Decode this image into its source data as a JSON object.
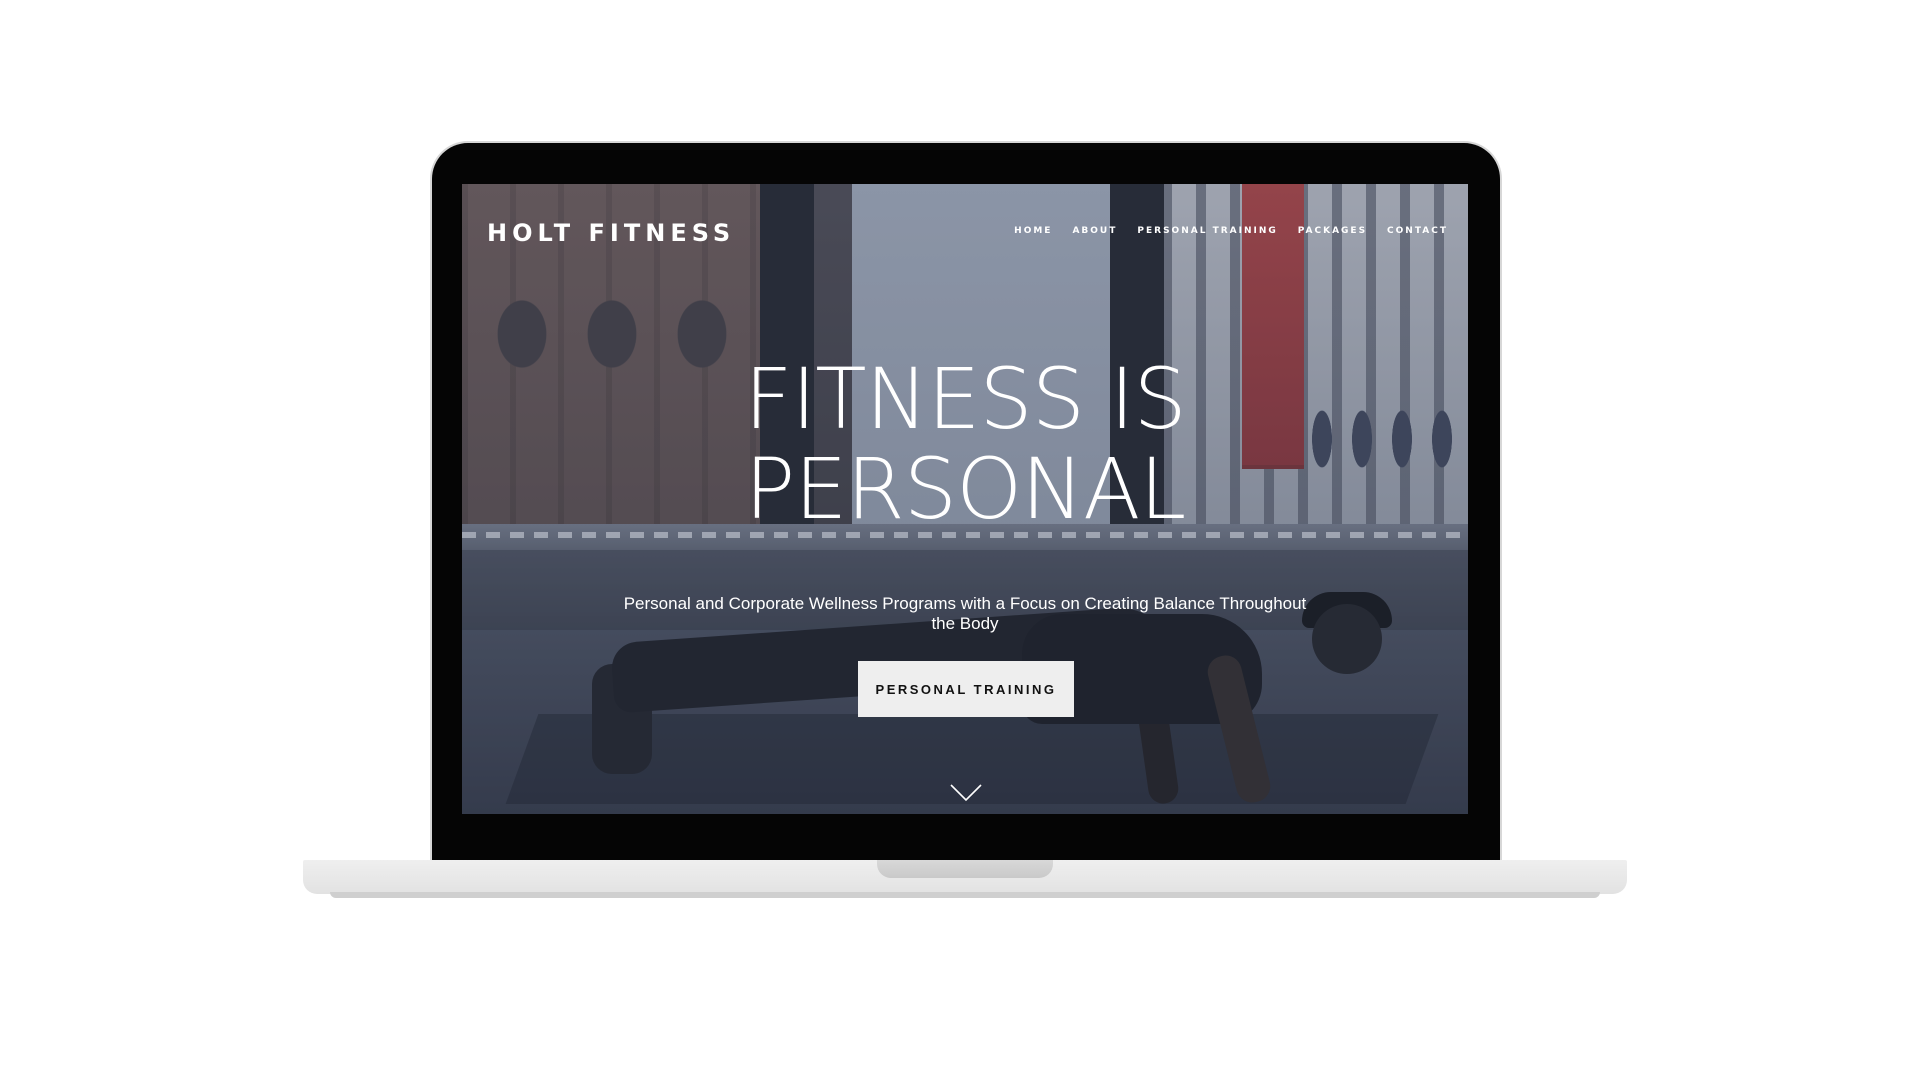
{
  "site": {
    "logo": "HOLT FITNESS"
  },
  "nav": {
    "items": [
      {
        "label": "HOME"
      },
      {
        "label": "ABOUT"
      },
      {
        "label": "PERSONAL TRAINING"
      },
      {
        "label": "PACKAGES"
      },
      {
        "label": "CONTACT"
      }
    ]
  },
  "hero": {
    "title_line1": "FITNESS IS",
    "title_line2": "PERSONAL",
    "subtitle": "Personal and Corporate Wellness Programs with a Focus on Creating Balance Throughout the Body",
    "cta_label": "PERSONAL TRAINING",
    "scroll_icon": "chevron-down-icon"
  },
  "colors": {
    "text": "#ffffff",
    "button_bg": "#eeeeee",
    "button_text": "#111111",
    "laptop_bezel": "#050505",
    "laptop_base": "#e6e6e6"
  }
}
